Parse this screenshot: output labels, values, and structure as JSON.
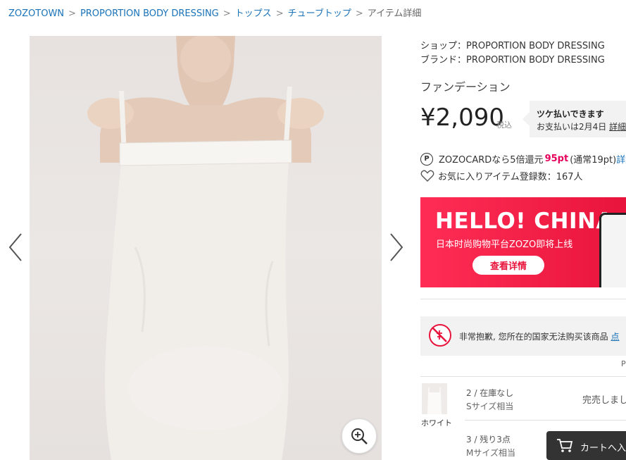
{
  "breadcrumb": {
    "items": [
      "ZOZOTOWN",
      "PROPORTION BODY DRESSING",
      "トップス",
      "チューブトップ"
    ],
    "current": "アイテム詳細",
    "separator": ">"
  },
  "product": {
    "shop": "ショップ：PROPORTION BODY DRESSING",
    "brand": "ブランド：PROPORTION BODY DRESSING",
    "category": "ファンデーション",
    "price": "¥2,090",
    "tax_label": "税込"
  },
  "tsuke": {
    "title": "ツケ払いできます",
    "date_text": "お支払いは2月4日",
    "detail_link": "詳細"
  },
  "points": {
    "icon_letter": "P",
    "prefix": "ZOZOCARDなら5倍還元",
    "value": "95pt",
    "normal": "(通常19pt)",
    "link": "詳細"
  },
  "favorite": {
    "text": "お気に入りアイテム登録数：167人"
  },
  "banner": {
    "headline": "HELLO! CHINA",
    "subtitle": "日本时尚购物平台ZOZO即将上线",
    "button": "查看详情"
  },
  "notice": {
    "text": "非常抱歉, 您所在的国家无法购买该商品",
    "link": "点"
  },
  "stray_text": "P",
  "variant": {
    "color_name": "ホワイト",
    "sizes": [
      {
        "number": "2 / 在庫なし",
        "label": "Sサイズ相当",
        "status": "完売しまし"
      },
      {
        "number": "3 / 残り3点",
        "label": "Mサイズ相当"
      }
    ]
  },
  "cart_button": {
    "label": "カートへ入"
  },
  "colors": {
    "link": "#1a73b8",
    "accent": "#e6005c",
    "banner": "#e8143c",
    "cart": "#333333"
  }
}
